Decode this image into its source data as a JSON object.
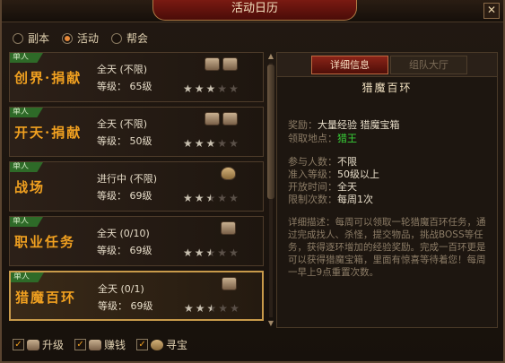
{
  "window": {
    "title": "活动日历",
    "close_glyph": "✕"
  },
  "radios": [
    {
      "label": "副本",
      "checked": false
    },
    {
      "label": "活动",
      "checked": true
    },
    {
      "label": "帮会",
      "checked": false
    }
  ],
  "activities": [
    {
      "badge": "单人",
      "name": "创界·捐献",
      "time": "全天 (不限)",
      "level": "等级： 65级",
      "icons": [
        "scroll-icon",
        "chest-icon"
      ],
      "stars": [
        1,
        1,
        1,
        0,
        0
      ]
    },
    {
      "badge": "单人",
      "name": "开天·捐献",
      "time": "全天 (不限)",
      "level": "等级： 50级",
      "icons": [
        "scroll-icon",
        "chest-icon"
      ],
      "stars": [
        1,
        1,
        1,
        0,
        0
      ]
    },
    {
      "badge": "单人",
      "name": "战场",
      "time": "进行中 (不限)",
      "level": "等级： 69级",
      "icons": [
        "money-bag-icon"
      ],
      "stars": [
        1,
        1,
        0.5,
        0,
        0
      ]
    },
    {
      "badge": "单人",
      "name": "职业任务",
      "time": "全天 (0/10)",
      "level": "等级： 69级",
      "icons": [
        "scroll-icon"
      ],
      "stars": [
        1,
        1,
        0.5,
        0,
        0
      ]
    },
    {
      "badge": "单人",
      "name": "猎魔百环",
      "time": "全天 (0/1)",
      "level": "等级： 69级",
      "icons": [
        "scroll-icon"
      ],
      "stars": [
        1,
        1,
        0.5,
        0,
        0
      ],
      "selected": true
    }
  ],
  "detail": {
    "tab_active": "详细信息",
    "tab_inactive": "组队大厅",
    "title": "猎魔百环",
    "reward_label": "奖励：",
    "reward_value": "大量经验  猎魔宝箱",
    "location_label": "领取地点：",
    "location_value": "猎王",
    "participants_label": "参与人数：",
    "participants_value": "不限",
    "level_label": "准入等级：",
    "level_value": "50级以上",
    "opentime_label": "开放时间：",
    "opentime_value": "全天",
    "limit_label": "限制次数：",
    "limit_value": "每周1次",
    "desc": "详细描述：每周可以领取一轮猎魔百环任务，通过完成找人、杀怪，提交物品，挑战BOSS等任务，获得逐环增加的经验奖励。完成一百环更是可以获得猎魔宝箱，里面有惊喜等待着您！每周一早上9点重置次数。"
  },
  "filters": [
    {
      "label": "升级",
      "icon": "scroll-icon",
      "checked": true
    },
    {
      "label": "赚钱",
      "icon": "chest-icon",
      "checked": true
    },
    {
      "label": "寻宝",
      "icon": "money-bag-icon",
      "checked": true
    }
  ],
  "colors": {
    "accent": "#f0a020",
    "green": "#38d038",
    "badge": "#2e6a28"
  }
}
